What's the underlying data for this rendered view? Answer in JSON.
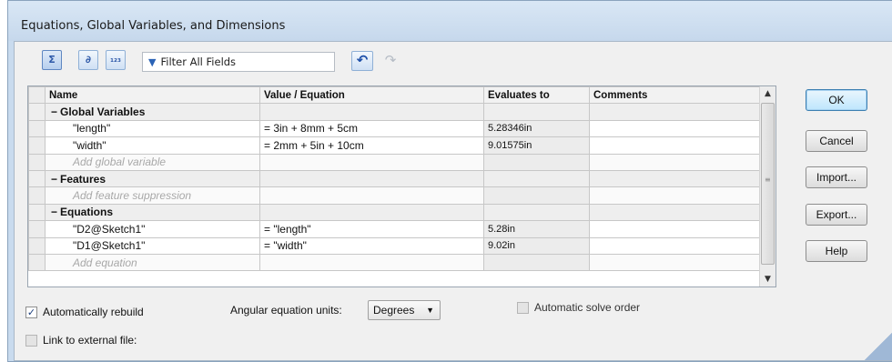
{
  "window": {
    "title": "Equations, Global Variables, and Dimensions"
  },
  "toolbar": {
    "buttons": [
      {
        "name": "equation-view-button",
        "glyph": "Σ"
      },
      {
        "name": "sketch-equation-view-button",
        "glyph": "∂"
      },
      {
        "name": "ordered-view-button",
        "glyph": "₁₂₃"
      }
    ],
    "filter": {
      "label": "Filter All Fields"
    },
    "undo_glyph": "↶",
    "redo_glyph": "↷"
  },
  "table": {
    "columns": [
      "Name",
      "Value / Equation",
      "Evaluates to",
      "Comments"
    ],
    "groups": {
      "global": {
        "title": "Global Variables"
      },
      "features": {
        "title": "Features"
      },
      "equations": {
        "title": "Equations"
      }
    },
    "rows": {
      "length": {
        "name": "\"length\"",
        "value": "= 3in + 8mm + 5cm",
        "evaluates": "5.28346in",
        "comment": ""
      },
      "width": {
        "name": "\"width\"",
        "value": "= 2mm + 5in + 10cm",
        "evaluates": "9.01575in",
        "comment": ""
      },
      "d2": {
        "name": "\"D2@Sketch1\"",
        "value": "= \"length\"",
        "evaluates": "5.28in",
        "comment": ""
      },
      "d1": {
        "name": "\"D1@Sketch1\"",
        "value": "= \"width\"",
        "evaluates": "9.02in",
        "comment": ""
      }
    },
    "placeholders": {
      "global": "Add global variable",
      "features": "Add feature suppression",
      "equations": "Add equation"
    },
    "group_toggle": "−"
  },
  "buttons": {
    "ok": "OK",
    "cancel": "Cancel",
    "import": "Import...",
    "export": "Export...",
    "help": "Help"
  },
  "options": {
    "auto_rebuild": {
      "label": "Automatically rebuild",
      "checked": true,
      "mark": "✓"
    },
    "angular_units": {
      "label": "Angular equation units:",
      "value": "Degrees",
      "arrow": "▼"
    },
    "auto_solve": {
      "label": "Automatic solve order",
      "checked": false
    },
    "link_external": {
      "label": "Link to external file:",
      "checked": false
    }
  },
  "scrollbar": {
    "up": "▲",
    "down": "▼",
    "grip": "≡"
  }
}
